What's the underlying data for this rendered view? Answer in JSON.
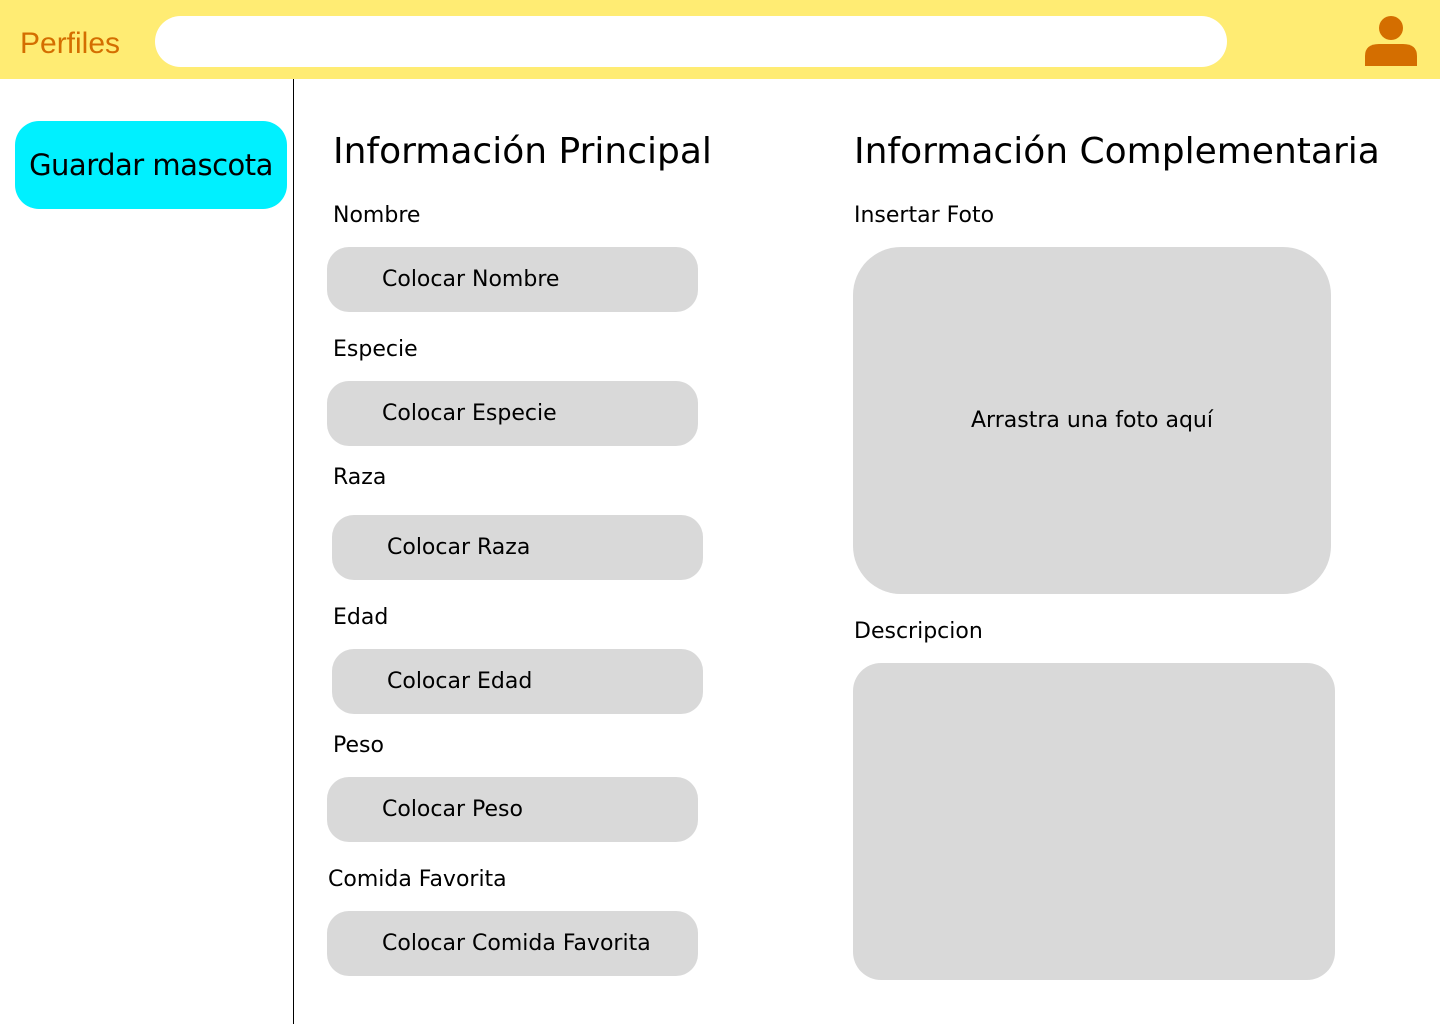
{
  "header": {
    "title": "Perfiles",
    "search_placeholder": "",
    "user_icon": "user-icon",
    "bar_color": "#ffec73",
    "title_color": "#d46e00",
    "icon_color": "#d46e00"
  },
  "sidebar": {
    "save_button_label": "Guardar mascota",
    "save_button_color": "#00f0ff"
  },
  "main_info": {
    "title": "Información Principal",
    "fields": [
      {
        "label": "Nombre",
        "placeholder": "Colocar Nombre"
      },
      {
        "label": "Especie",
        "placeholder": "Colocar Especie"
      },
      {
        "label": "Raza",
        "placeholder": "Colocar Raza"
      },
      {
        "label": "Edad",
        "placeholder": "Colocar Edad"
      },
      {
        "label": "Peso",
        "placeholder": "Colocar Peso"
      },
      {
        "label": "Comida Favorita",
        "placeholder": "Colocar Comida Favorita"
      }
    ]
  },
  "complementary_info": {
    "title": "Información Complementaria",
    "photo_label": "Insertar Foto",
    "photo_drop_text": "Arrastra una foto aquí",
    "description_label": "Descripcion"
  }
}
